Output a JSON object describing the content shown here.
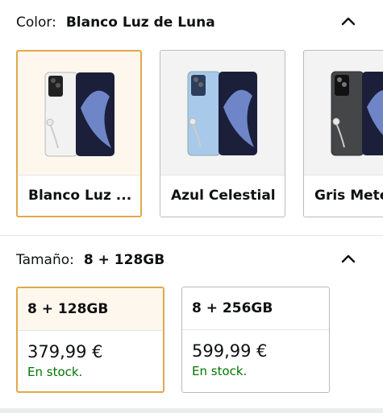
{
  "color_section": {
    "label": "Color:",
    "selected_value": "Blanco Luz de Luna",
    "options": [
      {
        "label": "Blanco Luz ...",
        "phone_color": "#f2f2f2",
        "selected": true
      },
      {
        "label": "Azul Celestial",
        "phone_color": "#a9c9ea",
        "selected": false
      },
      {
        "label": "Gris Mete",
        "phone_color": "#444648",
        "selected": false
      }
    ]
  },
  "size_section": {
    "label": "Tamaño:",
    "selected_value": "8 + 128GB",
    "options": [
      {
        "title": "8 + 128GB",
        "price": "379,99 €",
        "stock": "En stock.",
        "selected": true
      },
      {
        "title": "8 + 256GB",
        "price": "599,99 €",
        "stock": "En stock.",
        "selected": false
      }
    ]
  },
  "icons": {
    "collapse": "chevron-up-icon"
  },
  "colors": {
    "selected_border": "#e0a94c",
    "in_stock": "#007600",
    "selected_bg": "#fef7ed"
  }
}
